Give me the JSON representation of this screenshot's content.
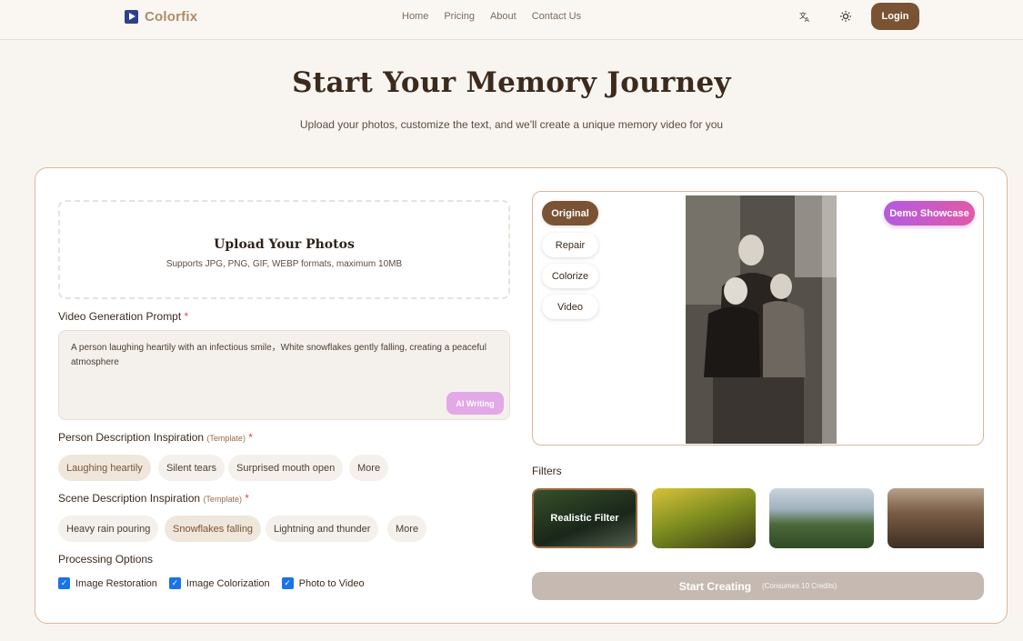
{
  "header": {
    "brand": "Colorfix",
    "nav": [
      "Home",
      "Pricing",
      "About",
      "Contact Us"
    ],
    "login_label": "Login",
    "icons": [
      "translate-icon",
      "sun-icon"
    ]
  },
  "hero": {
    "title": "Start Your Memory Journey",
    "subtitle": "Upload your photos, customize the text, and we'll create a unique memory video for you"
  },
  "upload": {
    "title": "Upload Your Photos",
    "formats": "Supports JPG, PNG, GIF, WEBP formats, maximum 10MB"
  },
  "prompt": {
    "label": "Video Generation Prompt",
    "required": "*",
    "value": "A person laughing heartily with an infectious smile，White snowflakes gently falling, creating a peaceful atmosphere",
    "ai_label": "AI Writing"
  },
  "person": {
    "label": "Person Description Inspiration",
    "template": "(Template)",
    "required": "*",
    "chips": [
      "Laughing heartily",
      "Silent tears",
      "Surprised mouth open",
      "More"
    ],
    "selected": "Laughing heartily"
  },
  "scene": {
    "label": "Scene Description Inspiration",
    "template": "(Template)",
    "required": "*",
    "chips": [
      "Heavy rain pouring",
      "Snowflakes falling",
      "Lightning and thunder",
      "More"
    ],
    "selected": "Snowflakes falling"
  },
  "processing": {
    "label": "Processing Options",
    "options": [
      {
        "label": "Image Restoration",
        "checked": true
      },
      {
        "label": "Image Colorization",
        "checked": true
      },
      {
        "label": "Photo to Video",
        "checked": true
      }
    ]
  },
  "preview": {
    "modes": [
      "Original",
      "Repair",
      "Colorize",
      "Video"
    ],
    "active_mode": "Original",
    "demo_label": "Demo Showcase"
  },
  "filters": {
    "label": "Filters",
    "items": [
      {
        "label": "Realistic Filter",
        "selected": true
      },
      {
        "label": "",
        "selected": false
      },
      {
        "label": "",
        "selected": false
      },
      {
        "label": "",
        "selected": false
      }
    ]
  },
  "start": {
    "label": "Start Creating",
    "credits": "(Consumes 10 Credits)"
  }
}
